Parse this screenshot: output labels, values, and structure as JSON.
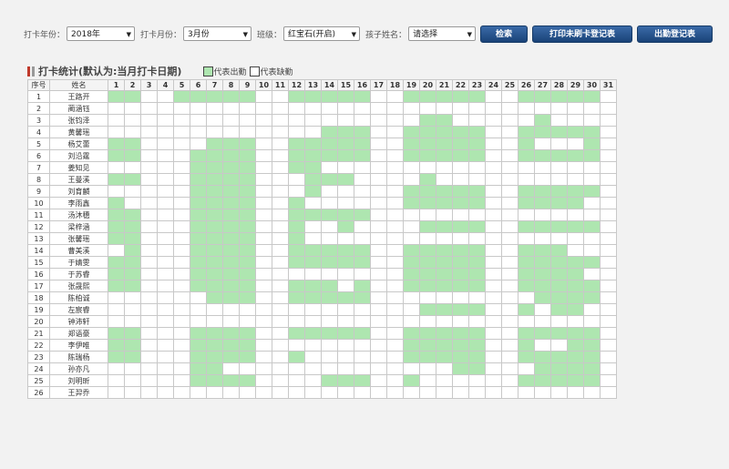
{
  "toolbar": {
    "year_label": "打卡年份：",
    "year_value": "2018年",
    "month_label": "打卡月份：",
    "month_value": "3月份",
    "class_label": "班级：",
    "class_value": "红宝石(开启)",
    "child_label": "孩子姓名：",
    "child_value": "请选择",
    "search_btn": "检索",
    "print_btn": "打印未刷卡登记表",
    "attendance_btn": "出勤登记表"
  },
  "section": {
    "title": "打卡统计(默认为:当月打卡日期)",
    "legend_present": "代表出勤",
    "legend_absent": "代表缺勤"
  },
  "table": {
    "col_index": "序号",
    "col_name": "姓名",
    "days": [
      "1",
      "2",
      "3",
      "4",
      "5",
      "6",
      "7",
      "8",
      "9",
      "10",
      "11",
      "12",
      "13",
      "14",
      "15",
      "16",
      "17",
      "18",
      "19",
      "20",
      "21",
      "22",
      "23",
      "24",
      "25",
      "26",
      "27",
      "28",
      "29",
      "30",
      "31"
    ],
    "rows": [
      {
        "no": "1",
        "name": "王路开",
        "present": [
          1,
          2,
          5,
          6,
          7,
          8,
          9,
          12,
          13,
          14,
          15,
          16,
          19,
          20,
          21,
          22,
          23,
          26,
          27,
          28,
          29,
          30
        ]
      },
      {
        "no": "2",
        "name": "蔺涵钰",
        "present": []
      },
      {
        "no": "3",
        "name": "张钧泽",
        "present": [
          20,
          21,
          27
        ]
      },
      {
        "no": "4",
        "name": "黄馨瑶",
        "present": [
          14,
          15,
          16,
          19,
          20,
          21,
          22,
          23,
          26,
          27,
          28,
          29,
          30
        ]
      },
      {
        "no": "5",
        "name": "杨艾蕾",
        "present": [
          1,
          2,
          7,
          8,
          9,
          12,
          13,
          14,
          15,
          16,
          19,
          20,
          21,
          22,
          23,
          26,
          30
        ]
      },
      {
        "no": "6",
        "name": "刘沿霆",
        "present": [
          1,
          2,
          6,
          7,
          8,
          9,
          12,
          13,
          14,
          15,
          16,
          19,
          20,
          21,
          22,
          23,
          26,
          27,
          28,
          29,
          30
        ]
      },
      {
        "no": "7",
        "name": "姜知见",
        "present": [
          6,
          7,
          8,
          9,
          12,
          13
        ]
      },
      {
        "no": "8",
        "name": "王曼溪",
        "present": [
          1,
          2,
          6,
          7,
          8,
          9,
          13,
          14,
          15,
          20
        ]
      },
      {
        "no": "9",
        "name": "刘育麟",
        "present": [
          6,
          7,
          8,
          9,
          13,
          19,
          20,
          21,
          22,
          23,
          26,
          27,
          28,
          29,
          30
        ]
      },
      {
        "no": "10",
        "name": "李雨鑫",
        "present": [
          1,
          6,
          7,
          8,
          9,
          12,
          19,
          20,
          21,
          22,
          23,
          26,
          27,
          28,
          29
        ]
      },
      {
        "no": "11",
        "name": "汤沐穗",
        "present": [
          1,
          2,
          6,
          7,
          8,
          9,
          12,
          13,
          14,
          15,
          16
        ]
      },
      {
        "no": "12",
        "name": "梁梓涵",
        "present": [
          1,
          2,
          6,
          7,
          8,
          9,
          12,
          15,
          20,
          21,
          22,
          23,
          26,
          27,
          28,
          29,
          30
        ]
      },
      {
        "no": "13",
        "name": "张馨瑶",
        "present": [
          1,
          2,
          6,
          7,
          8,
          9,
          12
        ]
      },
      {
        "no": "14",
        "name": "曹美溪",
        "present": [
          2,
          6,
          7,
          8,
          9,
          12,
          13,
          14,
          15,
          16,
          19,
          20,
          21,
          22,
          23,
          26,
          27,
          28
        ]
      },
      {
        "no": "15",
        "name": "于婧雯",
        "present": [
          1,
          2,
          6,
          7,
          8,
          9,
          12,
          13,
          14,
          15,
          16,
          19,
          20,
          21,
          22,
          23,
          26,
          27,
          28,
          29,
          30
        ]
      },
      {
        "no": "16",
        "name": "于苏睿",
        "present": [
          1,
          2,
          6,
          7,
          8,
          9,
          19,
          20,
          21,
          22,
          23,
          26,
          27,
          28,
          29
        ]
      },
      {
        "no": "17",
        "name": "张晟熙",
        "present": [
          1,
          2,
          6,
          7,
          8,
          9,
          12,
          13,
          14,
          16,
          19,
          20,
          21,
          22,
          23,
          26,
          27,
          28,
          29,
          30
        ]
      },
      {
        "no": "18",
        "name": "陈柏诚",
        "present": [
          7,
          8,
          9,
          12,
          13,
          14,
          15,
          16,
          27,
          28,
          29,
          30
        ]
      },
      {
        "no": "19",
        "name": "左宸睿",
        "present": [
          20,
          21,
          22,
          23,
          26,
          28,
          29
        ]
      },
      {
        "no": "20",
        "name": "钟沛轩",
        "present": []
      },
      {
        "no": "21",
        "name": "郑语豪",
        "present": [
          1,
          2,
          6,
          7,
          8,
          9,
          12,
          13,
          14,
          15,
          16,
          19,
          20,
          21,
          22,
          23,
          26,
          27,
          28,
          29,
          30
        ]
      },
      {
        "no": "22",
        "name": "李伊唯",
        "present": [
          1,
          2,
          6,
          7,
          8,
          9,
          19,
          20,
          21,
          22,
          23,
          26,
          29,
          30
        ]
      },
      {
        "no": "23",
        "name": "陈瑞杨",
        "present": [
          1,
          2,
          6,
          7,
          8,
          9,
          12,
          19,
          20,
          21,
          22,
          23,
          26,
          27,
          28,
          29,
          30
        ]
      },
      {
        "no": "24",
        "name": "孙亦凡",
        "present": [
          6,
          7,
          22,
          23,
          27,
          28,
          29,
          30
        ]
      },
      {
        "no": "25",
        "name": "刘明昕",
        "present": [
          6,
          7,
          8,
          9,
          14,
          15,
          16,
          19,
          26,
          27,
          28,
          29,
          30
        ]
      },
      {
        "no": "26",
        "name": "王羿乔",
        "present": []
      }
    ]
  }
}
